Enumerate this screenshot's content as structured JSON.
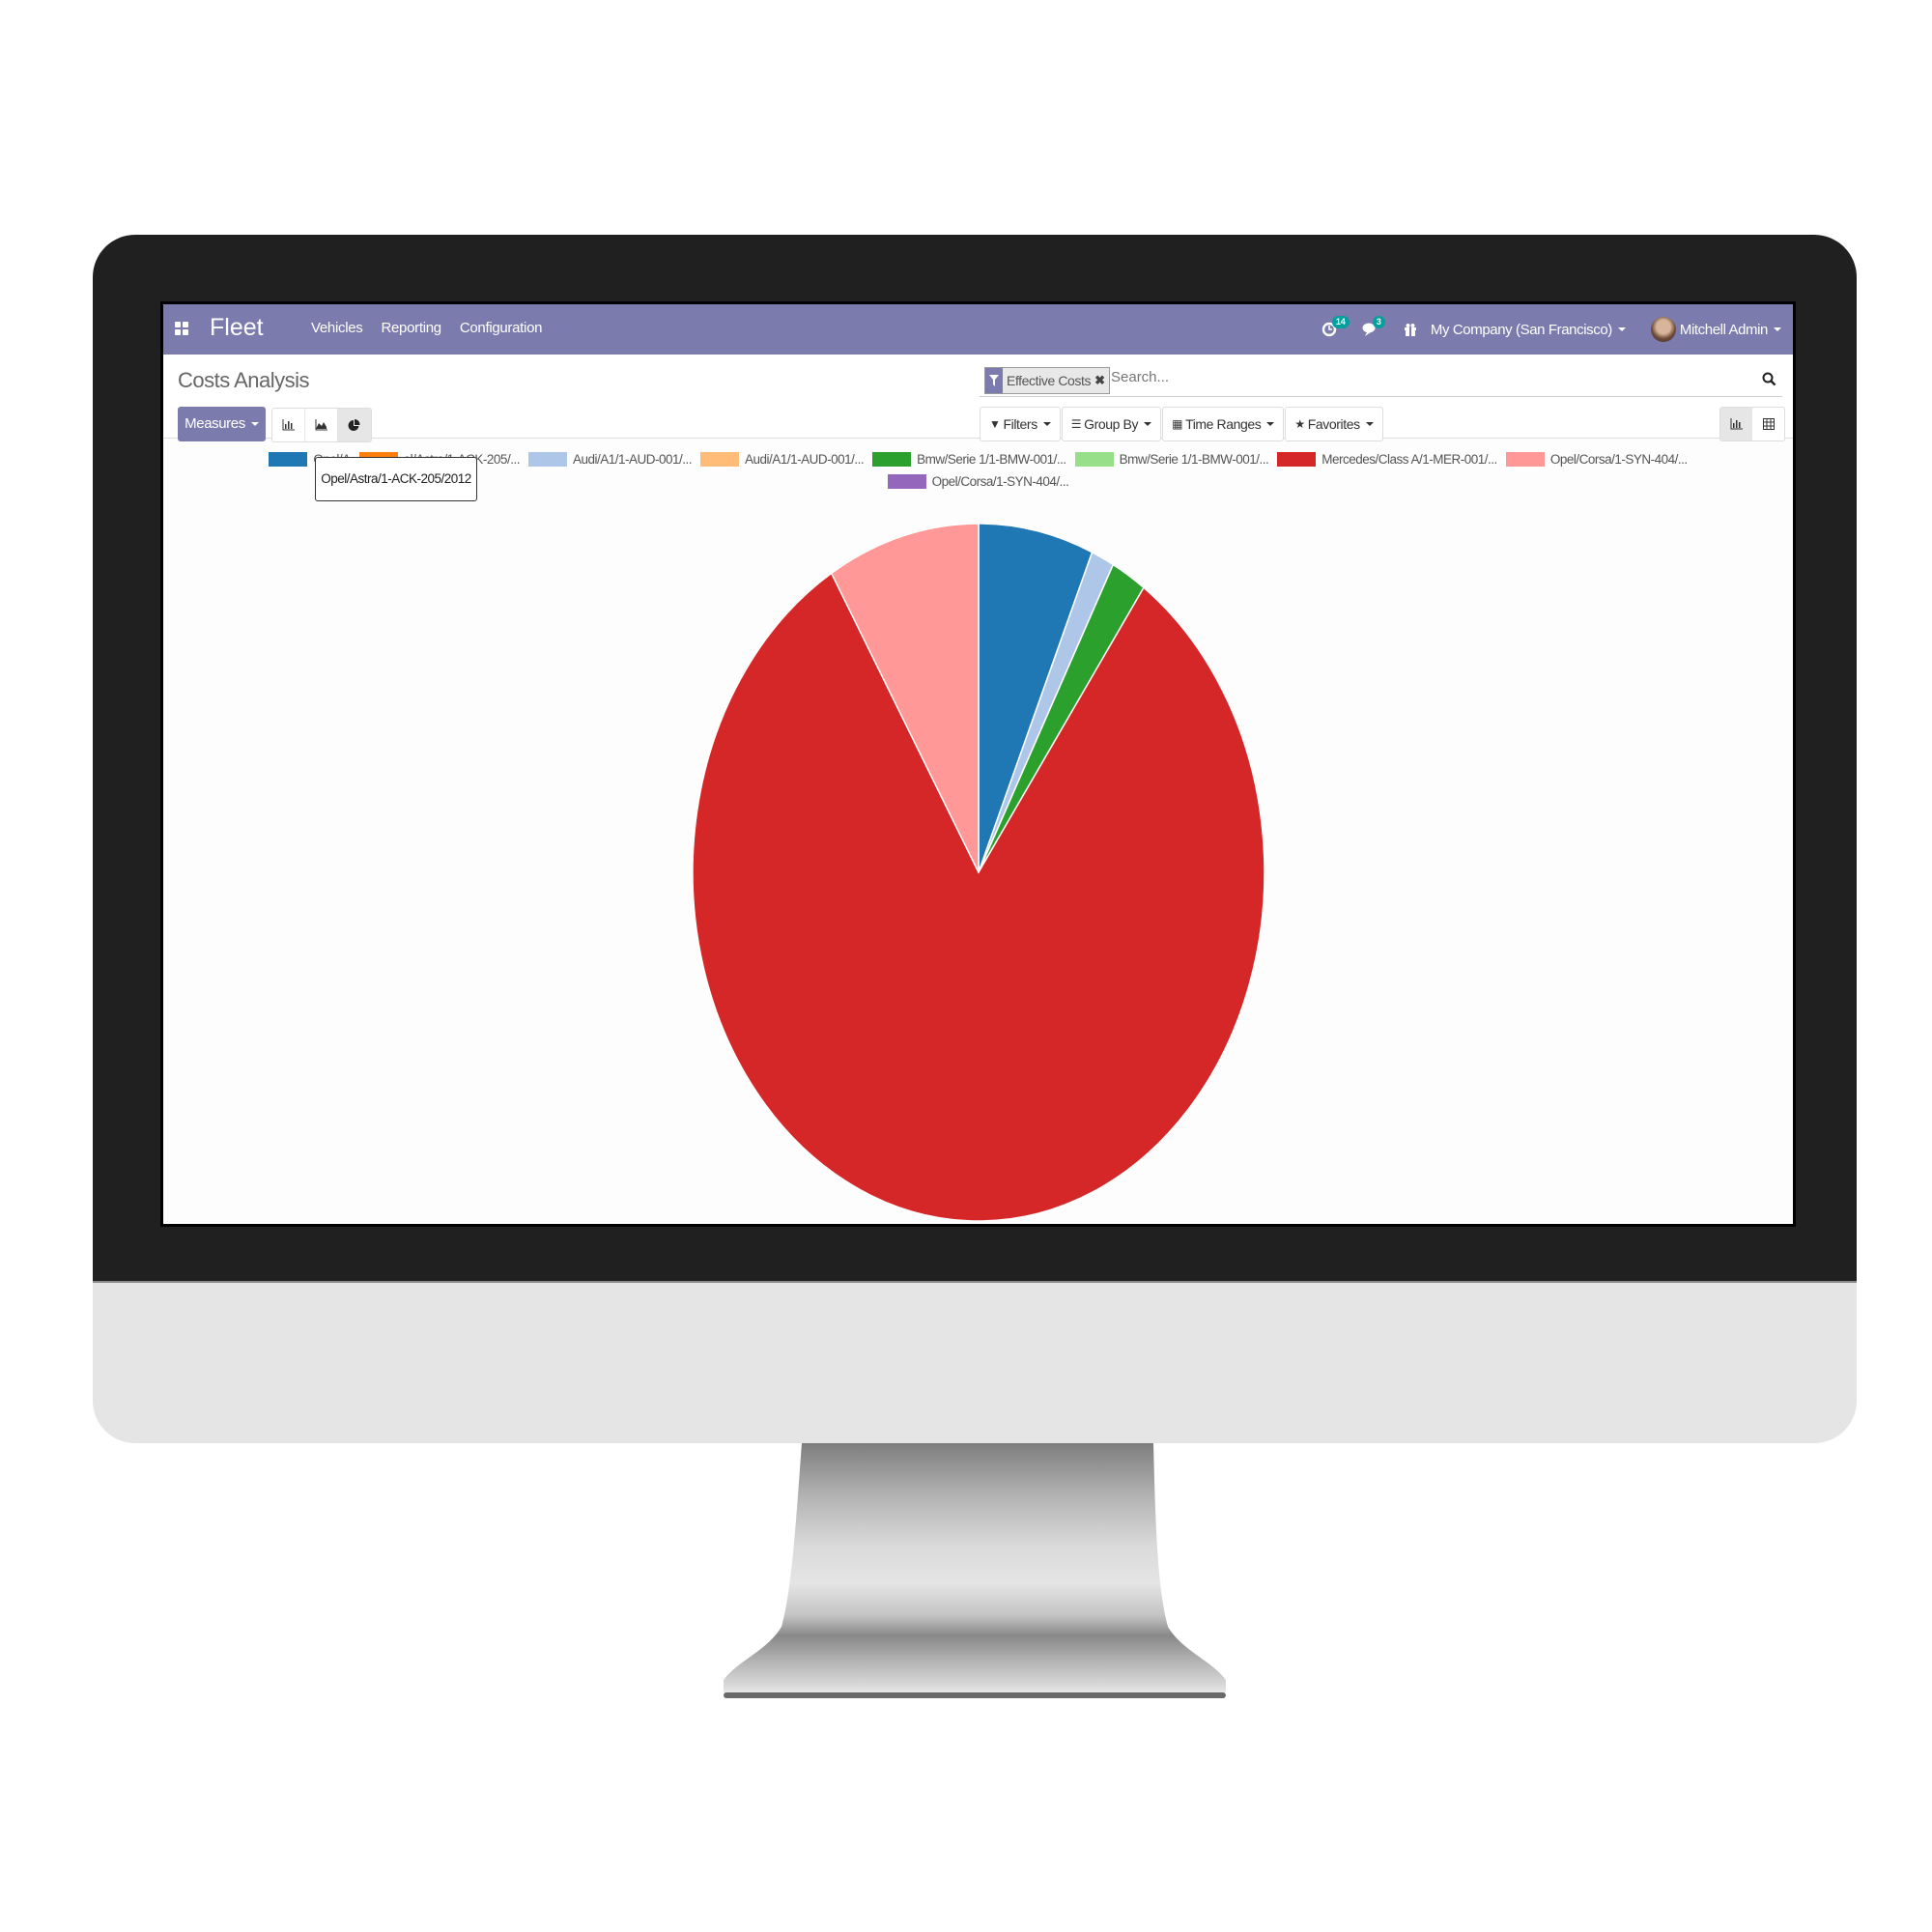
{
  "navbar": {
    "app_name": "Fleet",
    "menu": [
      "Vehicles",
      "Reporting",
      "Configuration"
    ],
    "activity_count": "14",
    "message_count": "3",
    "company": "My Company (San Francisco)",
    "user": "Mitchell Admin"
  },
  "control_panel": {
    "title": "Costs Analysis",
    "measures_label": "Measures",
    "chart_modes": [
      "bar-chart-icon",
      "line-chart-icon",
      "pie-chart-icon"
    ],
    "active_chart_mode": "pie",
    "search": {
      "facet_label": "Effective Costs",
      "placeholder": "Search..."
    },
    "filter_buttons": {
      "filters": "Filters",
      "group_by": "Group By",
      "time_ranges": "Time Ranges",
      "favorites": "Favorites"
    },
    "views": [
      "graph-view-icon",
      "pivot-view-icon"
    ],
    "active_view": "graph"
  },
  "tooltip": "Opel/Astra/1-ACK-205/2012",
  "chart_data": {
    "type": "pie",
    "title": "",
    "legend_position": "top",
    "slices": [
      {
        "label": "Opel/Astra/1-ACK-205/2012",
        "legend_text": "Opel/A",
        "color": "#1f77b4",
        "percent": 6.5
      },
      {
        "label": "Opel/Astra/1-ACK-205/...",
        "legend_text": "el/Astra/1-ACK-205/...",
        "color": "#ff7f0e",
        "percent": 0
      },
      {
        "label": "Audi/A1/1-AUD-001/...",
        "legend_text": "Audi/A1/1-AUD-001/...",
        "color": "#aec7e8",
        "percent": 1.3
      },
      {
        "label": "Audi/A1/1-AUD-001/...",
        "legend_text": "Audi/A1/1-AUD-001/...",
        "color": "#ffbb78",
        "percent": 0
      },
      {
        "label": "Bmw/Serie 1/1-BMW-001/...",
        "legend_text": "Bmw/Serie 1/1-BMW-001/...",
        "color": "#2ca02c",
        "percent": 2.0
      },
      {
        "label": "Bmw/Serie 1/1-BMW-001/...",
        "legend_text": "Bmw/Serie 1/1-BMW-001/...",
        "color": "#98df8a",
        "percent": 0
      },
      {
        "label": "Mercedes/Class A/1-MER-001/...",
        "legend_text": "Mercedes/Class A/1-MER-001/...",
        "color": "#d62728",
        "percent": 81.6
      },
      {
        "label": "Opel/Corsa/1-SYN-404/...",
        "legend_text": "Opel/Corsa/1-SYN-404/...",
        "color": "#ff9896",
        "percent": 8.6
      },
      {
        "label": "Opel/Corsa/1-SYN-404/...",
        "legend_text": "Opel/Corsa/1-SYN-404/...",
        "color": "#9467bd",
        "percent": 0
      }
    ]
  }
}
